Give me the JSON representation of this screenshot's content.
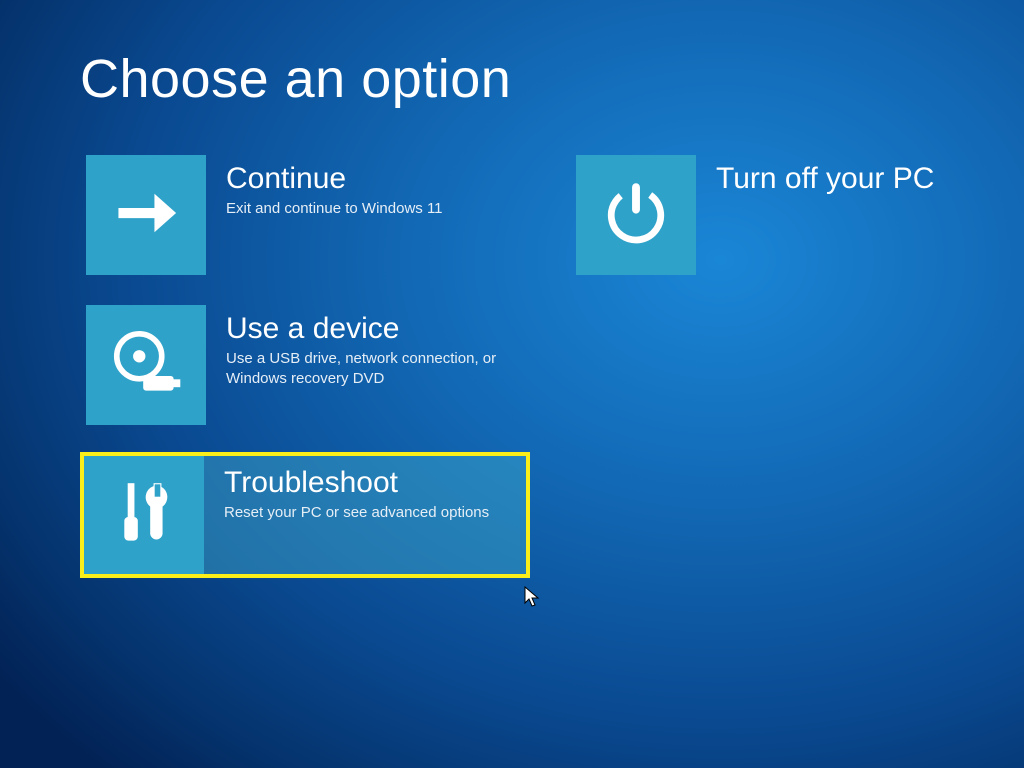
{
  "title": "Choose an option",
  "options": {
    "continue": {
      "label": "Continue",
      "desc": "Exit and continue to Windows 11"
    },
    "use_device": {
      "label": "Use a device",
      "desc": "Use a USB drive, network connection, or Windows recovery DVD"
    },
    "troubleshoot": {
      "label": "Troubleshoot",
      "desc": "Reset your PC or see advanced options"
    },
    "turn_off": {
      "label": "Turn off your PC",
      "desc": ""
    }
  }
}
